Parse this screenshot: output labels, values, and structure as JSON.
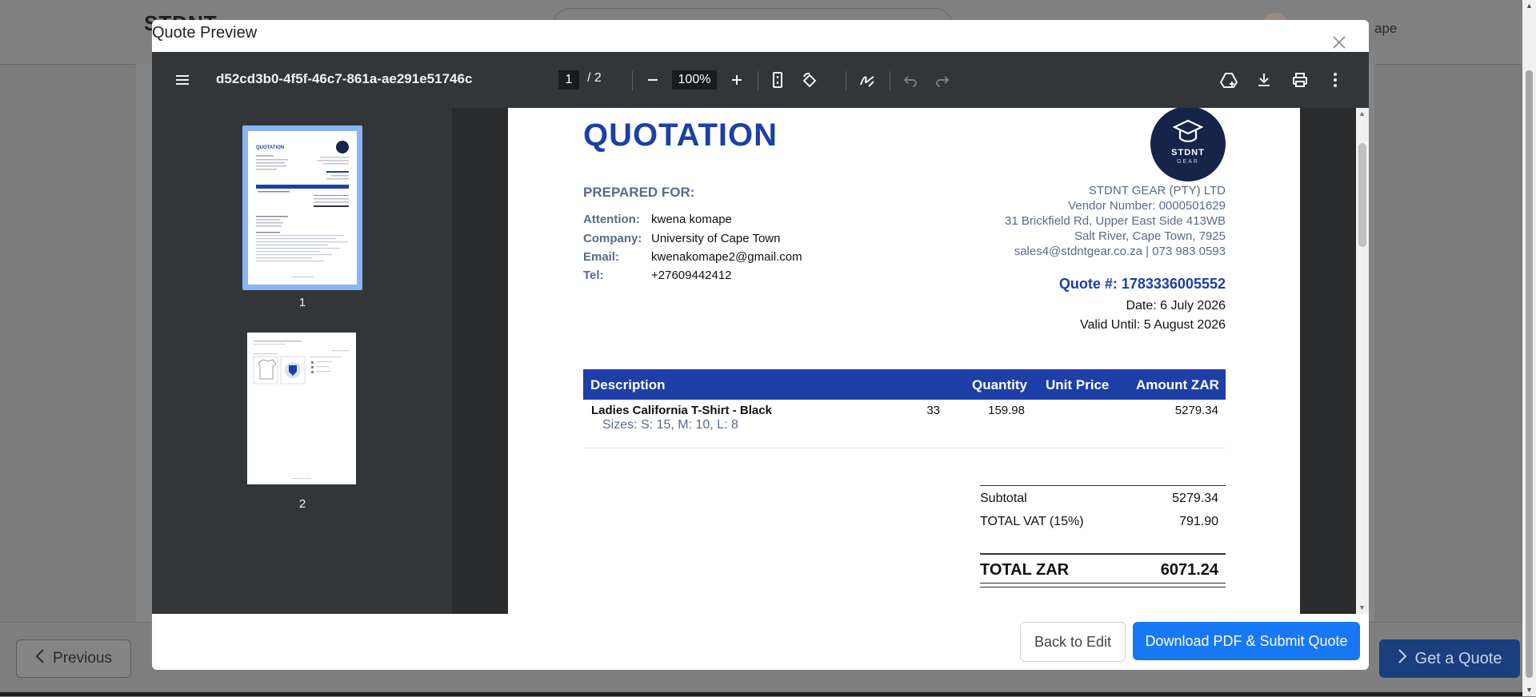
{
  "background": {
    "logo_text": "STDNT",
    "user_name": "ape",
    "prev_label": "Previous",
    "quote_label": "Get a Quote"
  },
  "modal": {
    "title": "Quote Preview",
    "close_icon": "close-icon"
  },
  "viewer": {
    "doc_name": "d52cd3b0-4f5f-46c7-861a-ae291e51746c",
    "current_page": "1",
    "page_total": "/  2",
    "zoom": "100%",
    "thumbnails": [
      {
        "label": "1"
      },
      {
        "label": "2"
      }
    ]
  },
  "quote": {
    "title": "QUOTATION",
    "logo_name": "STDNT",
    "logo_sub": "GEAR",
    "prepared_for": "PREPARED FOR:",
    "fields": [
      {
        "label": "Attention:",
        "value": "kwena komape"
      },
      {
        "label": "Company:",
        "value": "University of Cape Town"
      },
      {
        "label": "Email:",
        "value": "kwenakomape2@gmail.com"
      },
      {
        "label": "Tel:",
        "value": "+27609442412"
      }
    ],
    "vendor": {
      "name": "STDNT GEAR (PTY) LTD",
      "vendor_number": "Vendor Number: 0000501629",
      "address1": "31 Brickfield Rd, Upper East Side 413WB",
      "address2": "Salt River, Cape Town, 7925",
      "contact": "sales4@stdntgear.co.za | 073 983 0593"
    },
    "quote_number": "Quote #: 1783336005552",
    "date": "Date: 6 July 2026",
    "valid_until": "Valid Until: 5 August 2026",
    "table_headers": [
      "Description",
      "Quantity",
      "Unit Price",
      "Amount ZAR"
    ],
    "items": [
      {
        "description": "Ladies California T-Shirt - Black",
        "sizes": "Sizes: S: 15, M: 10, L: 8",
        "quantity": "33",
        "unit_price": "159.98",
        "amount": "5279.34"
      }
    ],
    "subtotal_label": "Subtotal",
    "subtotal": "5279.34",
    "vat_label": "TOTAL VAT (15%)",
    "vat": "791.90",
    "total_label": "TOTAL ZAR",
    "total": "6071.24"
  },
  "footer": {
    "back_label": "Back to Edit",
    "download_label": "Download PDF & Submit Quote"
  },
  "colors": {
    "accent_blue": "#1d3fa6",
    "button_blue": "#1877f2",
    "viewer_toolbar": "#323639"
  }
}
